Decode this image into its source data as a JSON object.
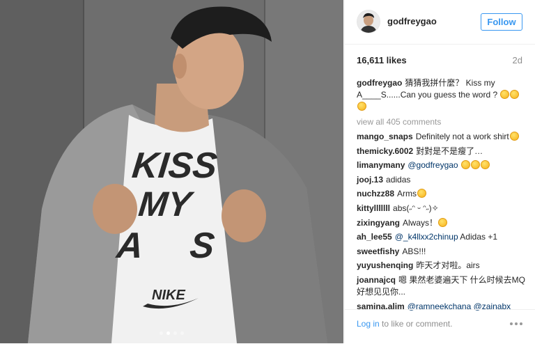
{
  "post": {
    "username": "godfreygao",
    "follow_label": "Follow",
    "likes": "16,611 likes",
    "age": "2d",
    "caption_text": "猜猜我拼什麼？ Kiss my A____S......Can you guess the word ?",
    "shirt_text": [
      "KISS",
      "MY",
      "A",
      "S"
    ],
    "shirt_brand": "NIKE",
    "view_all": "view all 405 comments",
    "comments": [
      {
        "user": "mango_snaps",
        "text": "Definitely not a work shirt",
        "emoji": 1
      },
      {
        "user": "themicky.6002",
        "text": "對對是不是瘦了…",
        "emoji": 0
      },
      {
        "user": "limanymany",
        "mention": "@godfreygao",
        "text": "",
        "emoji": 3
      },
      {
        "user": "jooj.13",
        "text": "adidas",
        "emoji": 0
      },
      {
        "user": "nuchzz88",
        "text": "Arms",
        "emoji": 1
      },
      {
        "user": "kittylllllll",
        "text": "abs(˶ᵔ ᵕ ᵔ˶)✧",
        "emoji": 0
      },
      {
        "user": "zixingyang",
        "text": "Always！",
        "emoji": 1
      },
      {
        "user": "ah_lee55",
        "mention": "@_k4llxx2chinup",
        "text": "Adidas +1",
        "emoji": 0
      },
      {
        "user": "sweetfishy",
        "text": "ABS!!!",
        "emoji": 0
      },
      {
        "user": "yuyushenqing",
        "text": "昨天才对啦。airs",
        "emoji": 0
      },
      {
        "user": "joannajcq",
        "text": "嗯 果然老婆遍天下 什么时候去MQ 好想见见你...",
        "emoji": 0
      },
      {
        "user": "samina.alim",
        "mention": "@ramneekchana @zainabx",
        "text": "",
        "emoji": 0
      }
    ],
    "login_link": "Log in",
    "login_rest": " to like or comment.",
    "carousel_dots": 4,
    "active_dot": 1
  }
}
